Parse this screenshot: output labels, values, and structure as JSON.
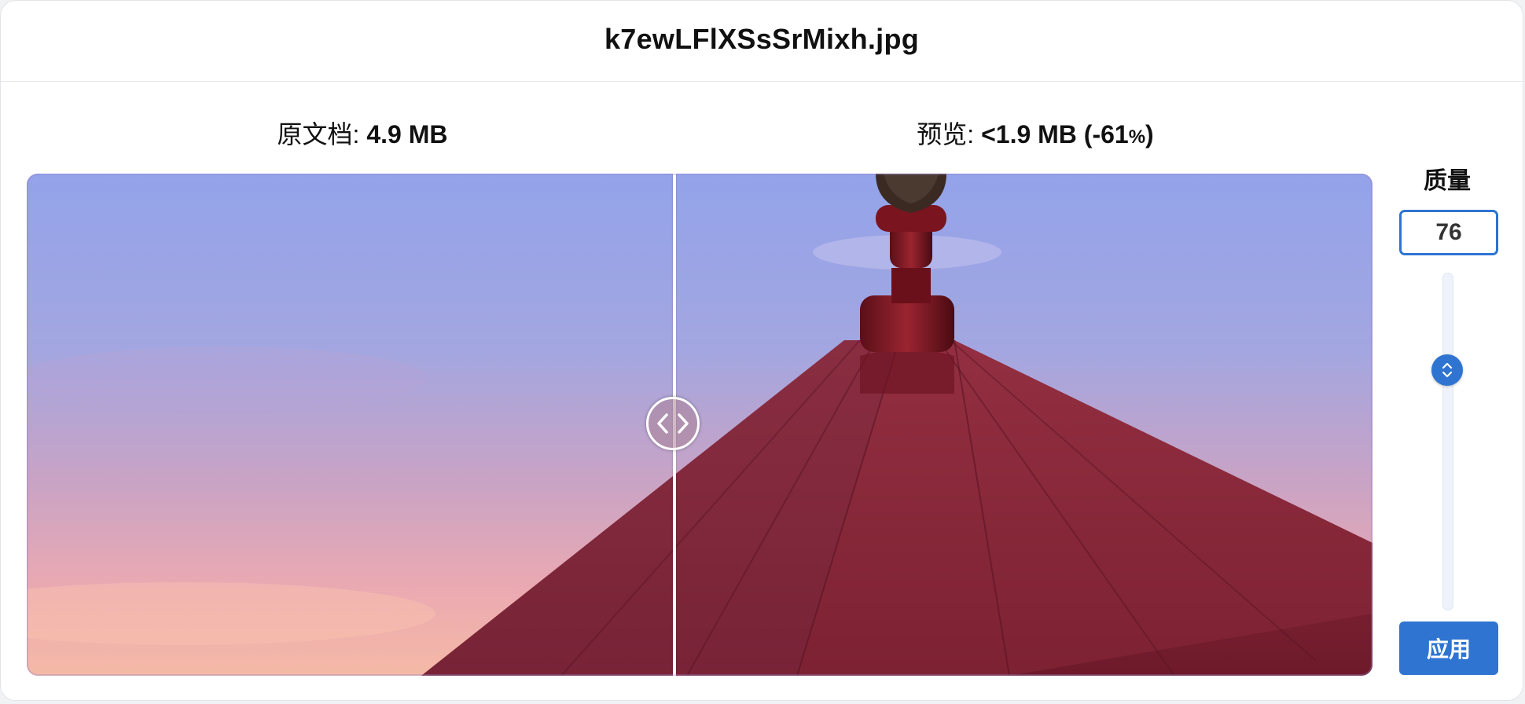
{
  "window": {
    "title": "k7ewLFlXSsSrMixh.jpg"
  },
  "original": {
    "label": "原文档",
    "size": "4.9 MB"
  },
  "preview": {
    "label": "预览",
    "size": "<1.9 MB (-61",
    "percent_sign": "%",
    "close_paren": ")"
  },
  "compare": {
    "split_fraction": 0.48,
    "handle_icon": "left-right-chevrons-icon"
  },
  "quality": {
    "label": "质量",
    "value": "76",
    "level": 76,
    "slider_icon": "up-down-chevrons-icon"
  },
  "actions": {
    "apply_label": "应用"
  },
  "colors": {
    "accent": "#2f74d0",
    "sky_top": "#93a3ea",
    "sky_bottom": "#f5b0a4",
    "roof": "#7a2030"
  }
}
